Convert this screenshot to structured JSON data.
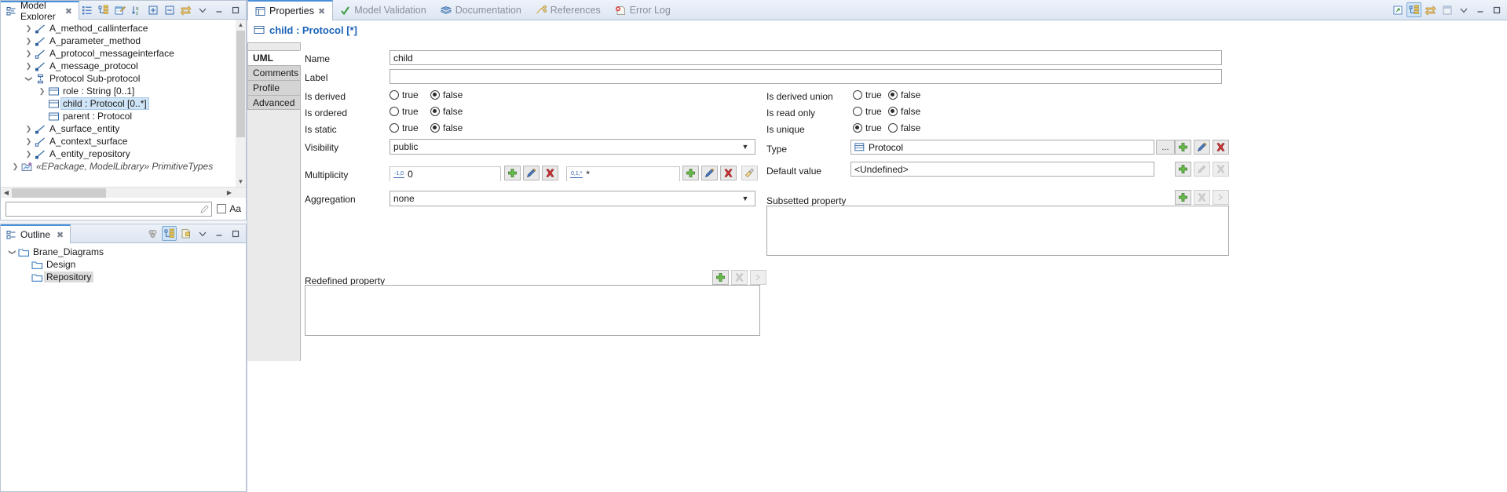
{
  "model_explorer": {
    "tab_label": "Model Explorer",
    "toolbar_icons": [
      "list-icon",
      "tree-icon",
      "edit-table-icon",
      "sort-az-icon",
      "expand-all-icon",
      "collapse-all-icon",
      "link-sync-icon",
      "view-menu-icon",
      "minimize-icon",
      "maximize-icon"
    ],
    "items": [
      {
        "label": "A_method_callinterface",
        "icon": "association-icon",
        "indent": 1,
        "arrow": "collapsed",
        "state": "normal"
      },
      {
        "label": "A_parameter_method",
        "icon": "association-icon",
        "indent": 1,
        "arrow": "collapsed",
        "state": "normal"
      },
      {
        "label": "A_protocol_messageinterface",
        "icon": "association-open-icon",
        "indent": 1,
        "arrow": "collapsed",
        "state": "normal"
      },
      {
        "label": "A_message_protocol",
        "icon": "association-icon",
        "indent": 1,
        "arrow": "collapsed",
        "state": "normal"
      },
      {
        "label": "Protocol Sub-protocol",
        "icon": "association-class-icon",
        "indent": 1,
        "arrow": "expanded",
        "state": "normal"
      },
      {
        "label": "role : String [0..1]",
        "icon": "property-icon",
        "indent": 2,
        "arrow": "collapsed",
        "state": "normal"
      },
      {
        "label": "child : Protocol [0..*]",
        "icon": "property-icon",
        "indent": 2,
        "arrow": "none",
        "state": "selected"
      },
      {
        "label": "parent : Protocol",
        "icon": "property-icon",
        "indent": 2,
        "arrow": "none",
        "state": "normal"
      },
      {
        "label": "A_surface_entity",
        "icon": "association-icon",
        "indent": 1,
        "arrow": "collapsed",
        "state": "normal"
      },
      {
        "label": "A_context_surface",
        "icon": "association-open-icon",
        "indent": 1,
        "arrow": "collapsed",
        "state": "normal"
      },
      {
        "label": "A_entity_repository",
        "icon": "association-icon",
        "indent": 1,
        "arrow": "collapsed",
        "state": "normal"
      },
      {
        "label": "«EPackage, ModelLibrary» PrimitiveTypes",
        "icon": "package-import-icon",
        "indent": 0,
        "arrow": "collapsed",
        "state": "italic"
      }
    ],
    "filter_value": "",
    "filter_placeholder": "",
    "case_sensitive_label": "Aa"
  },
  "outline": {
    "tab_label": "Outline",
    "toolbar_icons": [
      "overview-icon",
      "tree-outline-icon",
      "page-outline-icon",
      "view-menu-icon",
      "minimize-icon",
      "maximize-icon"
    ],
    "items": [
      {
        "label": "Brane_Diagrams",
        "icon": "folder-icon",
        "indent": 0,
        "arrow": "expanded",
        "state": "normal"
      },
      {
        "label": "Design",
        "icon": "folder-icon",
        "indent": 1,
        "arrow": "none",
        "state": "normal"
      },
      {
        "label": "Repository",
        "icon": "folder-icon",
        "indent": 1,
        "arrow": "none",
        "state": "selected-gray"
      }
    ]
  },
  "properties": {
    "tabs": [
      {
        "label": "Properties",
        "icon": "properties-icon",
        "active": true,
        "closable": true
      },
      {
        "label": "Model Validation",
        "icon": "check-icon",
        "active": false,
        "closable": false
      },
      {
        "label": "Documentation",
        "icon": "book-icon",
        "active": false,
        "closable": false
      },
      {
        "label": "References",
        "icon": "references-icon",
        "active": false,
        "closable": false
      },
      {
        "label": "Error Log",
        "icon": "error-log-icon",
        "active": false,
        "closable": false
      }
    ],
    "toolbar_icons": [
      "pin-icon",
      "tree-view-icon",
      "link-icon",
      "restore-icon",
      "view-menu-icon",
      "minimize-icon",
      "maximize-icon"
    ],
    "title": "child : Protocol [*]",
    "title_icon": "property-icon",
    "side_tabs": [
      {
        "label": "UML",
        "active": true
      },
      {
        "label": "Comments",
        "active": false
      },
      {
        "label": "Profile",
        "active": false
      },
      {
        "label": "Advanced",
        "active": false
      }
    ],
    "fields": {
      "name_label": "Name",
      "name_value": "child",
      "label_label": "Label",
      "label_value": "",
      "is_derived_label": "Is derived",
      "is_derived_value": "false",
      "is_ordered_label": "Is ordered",
      "is_ordered_value": "false",
      "is_static_label": "Is static",
      "is_static_value": "false",
      "visibility_label": "Visibility",
      "visibility_value": "public",
      "multiplicity_label": "Multiplicity",
      "multiplicity_lower": "0",
      "multiplicity_lower_icon": "-1,0",
      "multiplicity_upper": "*",
      "multiplicity_upper_icon": "0,1,*",
      "aggregation_label": "Aggregation",
      "aggregation_value": "none",
      "is_derived_union_label": "Is derived union",
      "is_derived_union_value": "false",
      "is_read_only_label": "Is read only",
      "is_read_only_value": "false",
      "is_unique_label": "Is unique",
      "is_unique_value": "true",
      "type_label": "Type",
      "type_value": "Protocol",
      "type_icon": "class-icon",
      "default_value_label": "Default value",
      "default_value_value": "<Undefined>",
      "subsetted_property_label": "Subsetted property",
      "redefined_property_label": "Redefined property",
      "radio_true_label": "true",
      "radio_false_label": "false",
      "browse_label": "..."
    }
  }
}
